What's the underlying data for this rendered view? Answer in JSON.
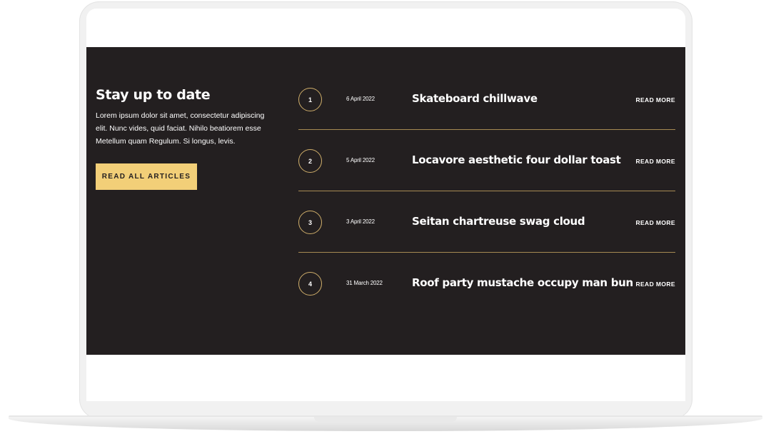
{
  "intro": {
    "heading": "Stay up to date",
    "body": "Lorem ipsum dolor sit amet, consectetur adipiscing elit. Nunc vides, quid faciat. Nihilo beatiorem esse Metellum quam Regulum. Si longus, levis.",
    "cta_label": "READ ALL ARTICLES"
  },
  "articles": [
    {
      "number": "1",
      "date": "6 April 2022",
      "title": "Skateboard chillwave",
      "link_label": "READ MORE"
    },
    {
      "number": "2",
      "date": "5 April 2022",
      "title": "Locavore aesthetic four dollar toast",
      "link_label": "READ MORE"
    },
    {
      "number": "3",
      "date": "3 April 2022",
      "title": "Seitan chartreuse swag cloud",
      "link_label": "READ MORE"
    },
    {
      "number": "4",
      "date": "31 March 2022",
      "title": "Roof party mustache occupy man bun",
      "link_label": "READ MORE"
    }
  ],
  "colors": {
    "section_bg": "#231f20",
    "accent": "#f2cf78",
    "divider": "#a68a53"
  }
}
